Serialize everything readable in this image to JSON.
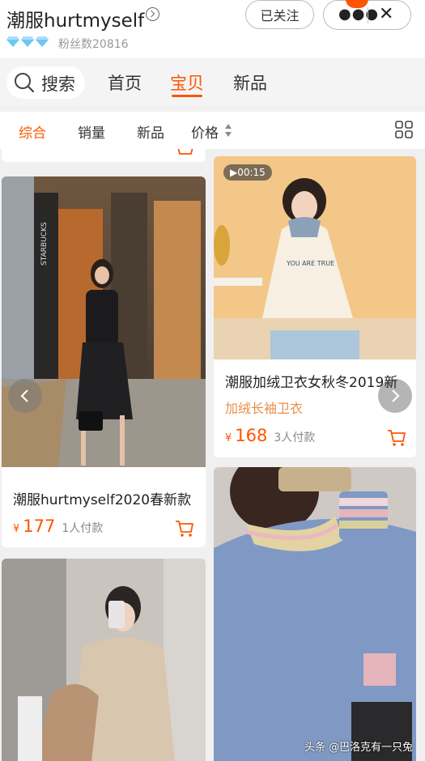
{
  "header": {
    "shop_name": "潮服hurtmyself",
    "fans": "粉丝数20816",
    "follow_label": "已关注",
    "notif_badge": "···",
    "more_icon": "more-dots-icon",
    "close_icon": "close-icon"
  },
  "nav": {
    "search_label": "搜索",
    "tabs": [
      "首页",
      "宝贝",
      "新品"
    ],
    "active_tab": "宝贝"
  },
  "sort": {
    "items": [
      "综合",
      "销量",
      "新品",
      "价格"
    ],
    "active": "综合",
    "layout_toggle_icon": "grid-view-icon"
  },
  "products": [
    {
      "title": "潮服hurtmyself2020春新款",
      "subtitle": "",
      "currency": "¥",
      "price": "177",
      "sold": "1人付款"
    },
    {
      "video_duration": "▶00:15",
      "title": "潮服加绒卫衣女秋冬2019新",
      "subtitle": "加绒长袖卫衣",
      "currency": "¥",
      "price": "168",
      "sold": "3人付款"
    }
  ],
  "watermark": "头条 @巴洛克有一只兔",
  "colors": {
    "accent": "#ff5500",
    "subtitle": "#e98f4d",
    "diamond": "#6ec6f5"
  }
}
